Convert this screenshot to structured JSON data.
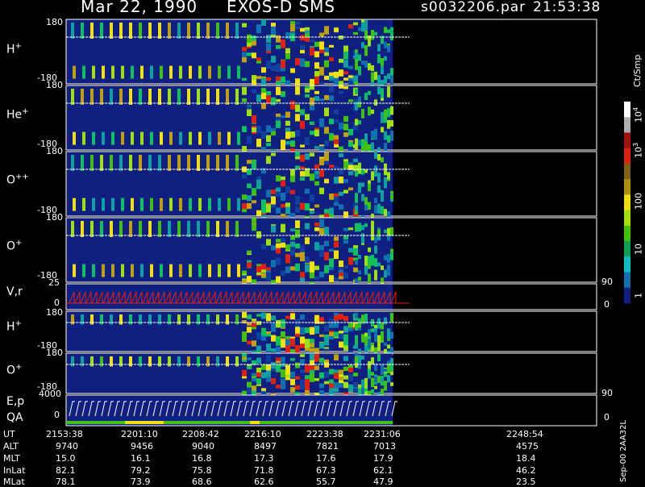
{
  "header": {
    "date": "Mar 22, 1990",
    "instrument": "EXOS-D SMS",
    "file": "s0032206.par",
    "time": "21:53:38"
  },
  "panels": [
    {
      "id": "h-plus",
      "label_base": "H",
      "label_sup": "+",
      "tick_top": "180",
      "tick_bottom": "-180"
    },
    {
      "id": "he-plus",
      "label_base": "He",
      "label_sup": "+",
      "tick_top": "180",
      "tick_bottom": "-180"
    },
    {
      "id": "o-plusplus",
      "label_base": "O",
      "label_sup": "++",
      "tick_top": "180",
      "tick_bottom": "-180"
    },
    {
      "id": "o-plus",
      "label_base": "O",
      "label_sup": "+",
      "tick_top": "180",
      "tick_bottom": "-180"
    },
    {
      "id": "vr",
      "label_base": "V,r",
      "label_sup": "",
      "tick_top": "25",
      "tick_bottom": "0",
      "right_top": "90",
      "right_bottom": "0"
    },
    {
      "id": "h-plus-2",
      "label_base": "H",
      "label_sup": "+",
      "tick_top": "180",
      "tick_bottom": "-180"
    },
    {
      "id": "o-plus-2",
      "label_base": "O",
      "label_sup": "+",
      "tick_top": "180",
      "tick_bottom": "-180",
      "right_bottom": "90"
    },
    {
      "id": "ep-qa",
      "label_base": "E,p",
      "label_base2": "QA",
      "label_sup": "",
      "tick_top": "4000",
      "tick_bottom": "0",
      "right_bottom": "0"
    }
  ],
  "colorbar": {
    "unit": "Ct/Smp",
    "labels": [
      {
        "base": "10",
        "exp": "4"
      },
      {
        "base": "10",
        "exp": "3"
      },
      {
        "base": "100",
        "exp": ""
      },
      {
        "base": "10",
        "exp": ""
      },
      {
        "base": "1",
        "exp": ""
      }
    ],
    "colors": [
      "#ffffff",
      "#b0b0b0",
      "#a01010",
      "#e02010",
      "#806010",
      "#b09010",
      "#f0e010",
      "#a0e010",
      "#40c010",
      "#10a050",
      "#10c0c0",
      "#1070b0",
      "#102080"
    ]
  },
  "footer": {
    "row_labels": [
      "UT",
      "ALT",
      "MLT",
      "InLat",
      "MLat"
    ],
    "columns": [
      {
        "UT": "2153:38",
        "ALT": "9740",
        "MLT": "15.0",
        "InLat": "82.1",
        "MLat": "78.1"
      },
      {
        "UT": "2201:10",
        "ALT": "9456",
        "MLT": "16.1",
        "InLat": "79.2",
        "MLat": "73.9"
      },
      {
        "UT": "2208:42",
        "ALT": "9040",
        "MLT": "16.8",
        "InLat": "75.8",
        "MLat": "68.6"
      },
      {
        "UT": "2216:10",
        "ALT": "8497",
        "MLT": "17.3",
        "InLat": "71.8",
        "MLat": "62.6"
      },
      {
        "UT": "2223:38",
        "ALT": "7821",
        "MLT": "17.6",
        "InLat": "67.3",
        "MLat": "55.7"
      },
      {
        "UT": "2231:06",
        "ALT": "7013",
        "MLT": "17.9",
        "InLat": "62.1",
        "MLat": "47.9"
      },
      {
        "UT": "2248:54",
        "ALT": "4575",
        "MLT": "18.4",
        "InLat": "46.2",
        "MLat": "23.5"
      }
    ],
    "stamp": "Sep-00 2AA32L"
  },
  "chart_data": {
    "type": "heatmap",
    "title": "Mar 22, 1990 EXOS-D SMS s0032206.par 21:53:38",
    "x_tick_labels": [
      "2153:38",
      "2201:10",
      "2208:42",
      "2216:10",
      "2223:38",
      "2231:06",
      "2248:54"
    ],
    "y_range": [
      -180,
      180
    ],
    "colorscale_unit": "Ct/Smp",
    "colorscale_range": [
      1,
      10000
    ],
    "colorscale_log": true,
    "series": [
      {
        "name": "H+"
      },
      {
        "name": "He+"
      },
      {
        "name": "O++"
      },
      {
        "name": "O+"
      },
      {
        "name": "V,r"
      },
      {
        "name": "H+"
      },
      {
        "name": "O+"
      },
      {
        "name": "E,p QA"
      }
    ]
  }
}
